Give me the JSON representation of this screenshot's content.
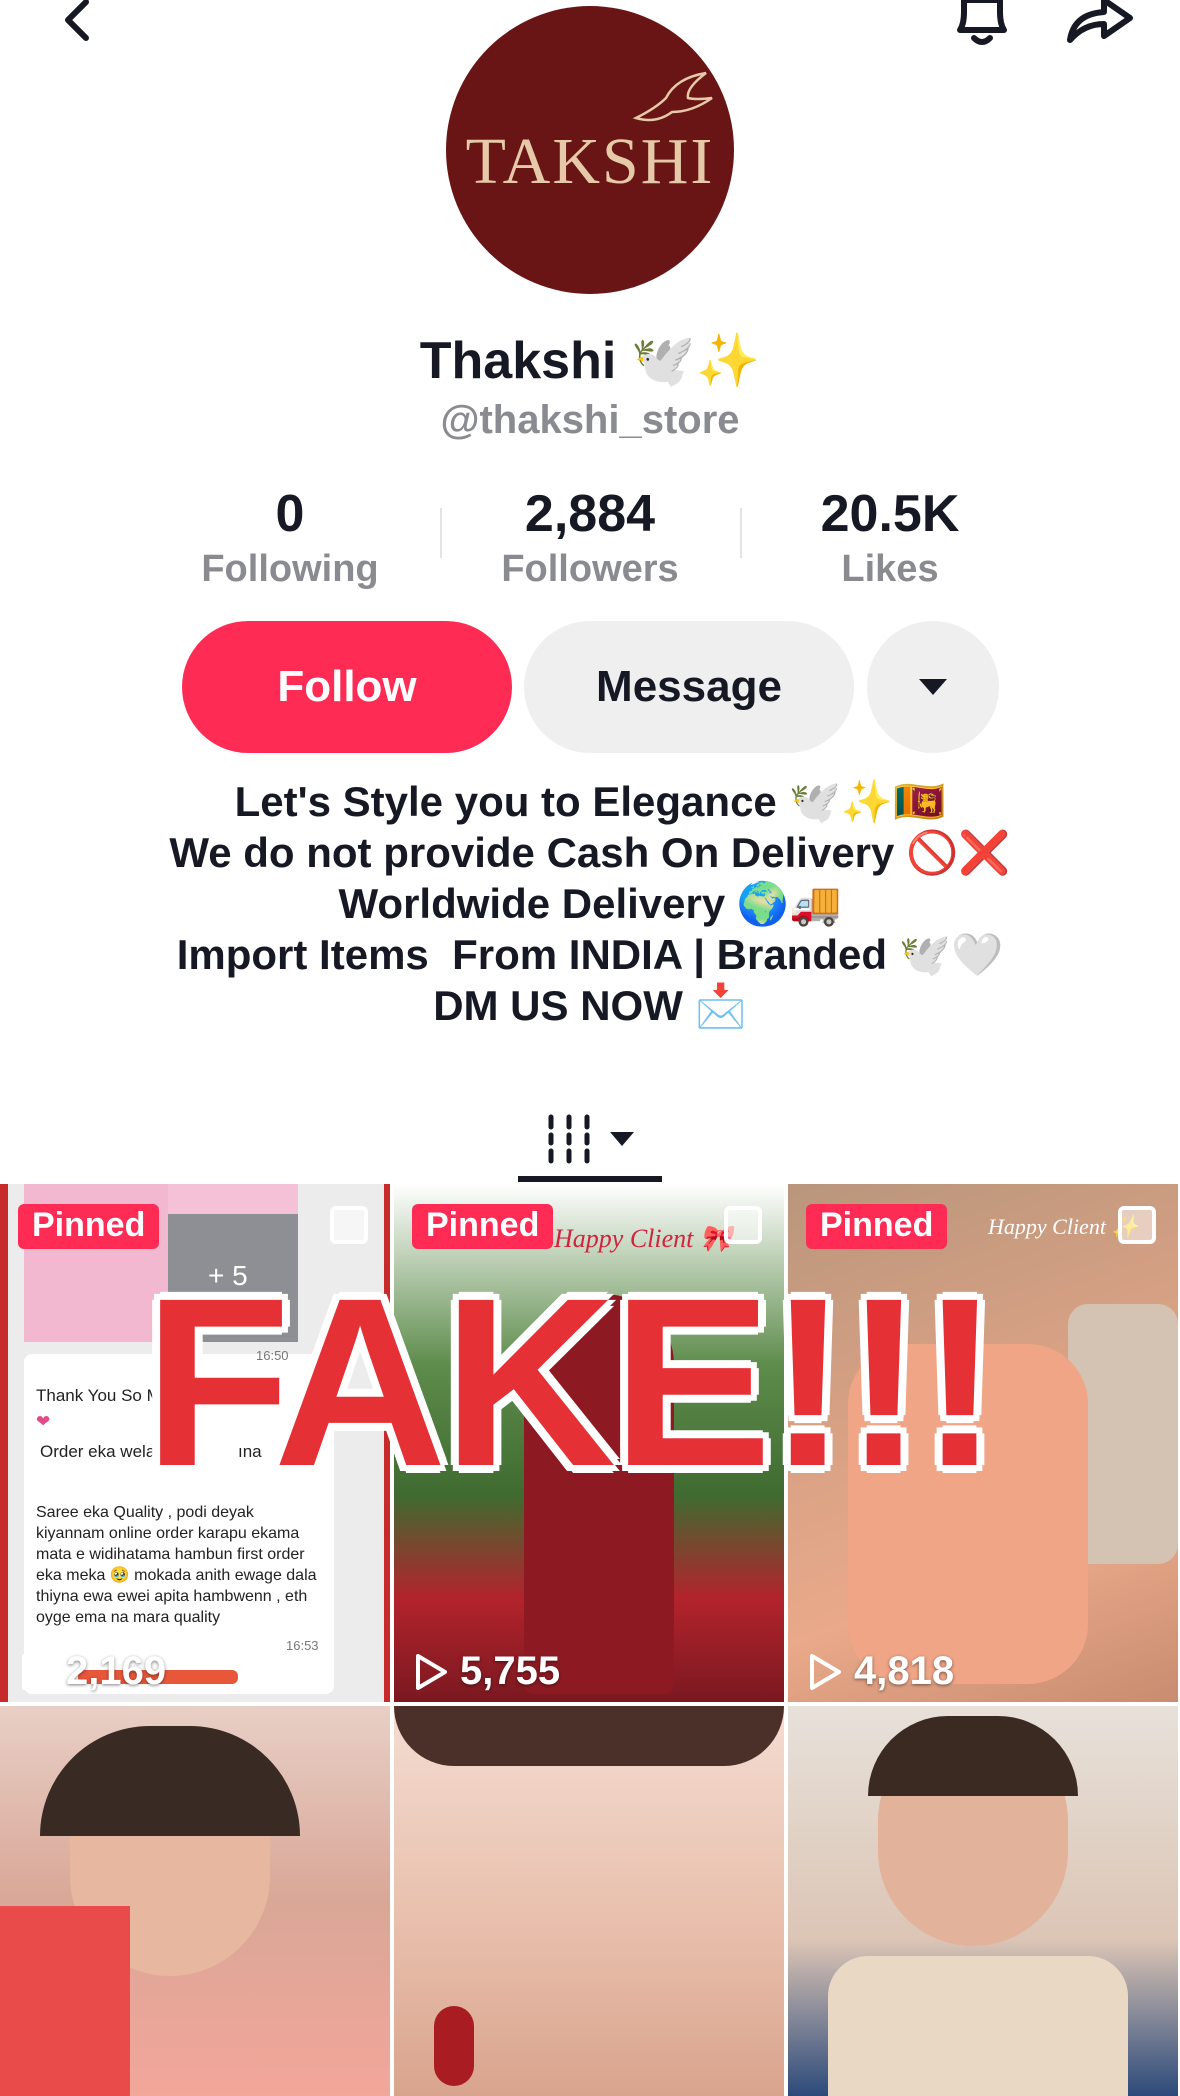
{
  "profile": {
    "display_name": "Thakshi 🕊️✨",
    "handle": "@thakshi_store",
    "avatar_logo_text": "TAKSHI"
  },
  "stats": [
    {
      "value": "0",
      "label": "Following"
    },
    {
      "value": "2,884",
      "label": "Followers"
    },
    {
      "value": "20.5K",
      "label": "Likes"
    }
  ],
  "actions": {
    "follow_label": "Follow",
    "message_label": "Message"
  },
  "bio": [
    "Let's Style you to Elegance 🕊️✨🇱🇰",
    "We do not provide Cash On Delivery 🚫❌",
    "Worldwide Delivery 🌍🚚",
    "Import Items  From INDIA | Branded 🕊️🤍",
    "DM US NOW 📩"
  ],
  "videos": [
    {
      "pinned_label": "Pinned",
      "views": "2,169"
    },
    {
      "pinned_label": "Pinned",
      "views": "5,755",
      "caption": "Happy Client 🎀"
    },
    {
      "pinned_label": "Pinned",
      "views": "4,818",
      "caption": "Happy Client ✨"
    }
  ],
  "chat_preview": {
    "photo_count": "+ 5",
    "time1": "16:50",
    "line1": "Thank You So Muc",
    "line2": "Order eka welawat",
    "line2b": "ına",
    "message": "Saree eka Quality , podi deyak kiyannam online order karapu ekama mata e widihatama hambun first order eka meka 🥹 mokada anith ewage dala thiyna ewa ewei apita hambwenn , eth oyge ema na mara quality",
    "time2": "16:53"
  },
  "overlay_text": "FAKE!!!",
  "colors": {
    "accent": "#fe2c55",
    "avatar_bg": "#6a1515",
    "overlay": "#e53035"
  }
}
